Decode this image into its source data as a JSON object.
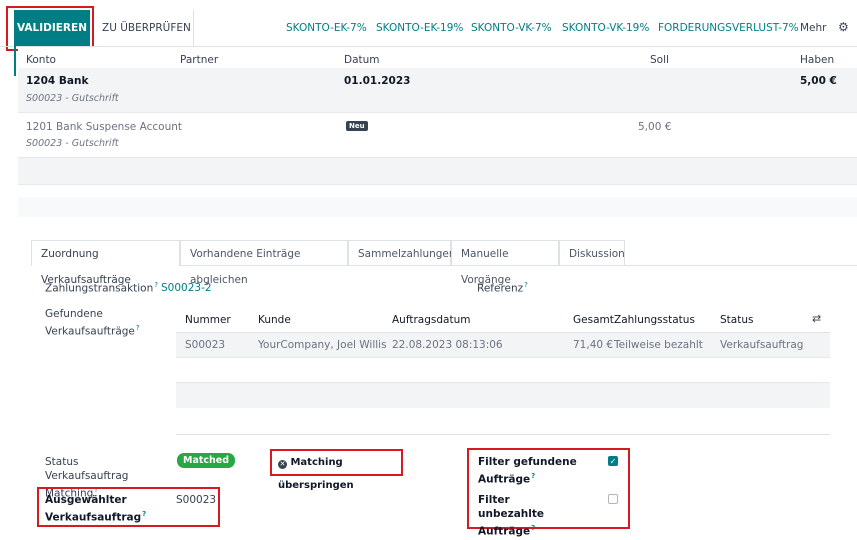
{
  "toolbar": {
    "validate": "VALIDIEREN",
    "to_check": "ZU ÜBERPRÜFEN",
    "actions": [
      "SKONTO-EK-7%",
      "SKONTO-EK-19%",
      "SKONTO-VK-7%",
      "SKONTO-VK-19%",
      "FORDERUNGSVERLUST-7%"
    ],
    "more": "Mehr"
  },
  "lines_table": {
    "headers": {
      "account": "Konto",
      "partner": "Partner",
      "date": "Datum",
      "debit": "Soll",
      "credit": "Haben"
    },
    "rows": [
      {
        "account": "1204 Bank",
        "label": "S00023 - Gutschrift",
        "date": "01.01.2023",
        "debit": "",
        "credit": "5,00 €"
      },
      {
        "account": "1201 Bank Suspense Account",
        "label": "S00023 - Gutschrift",
        "badge": "Neu",
        "debit": "5,00 €",
        "credit": ""
      }
    ]
  },
  "tabs": [
    "Zuordnung Verkaufsaufträge",
    "Vorhandene Einträge abgleichen",
    "Sammelzahlungen",
    "Manuelle Vorgänge",
    "Diskussion"
  ],
  "form": {
    "transaction_label": "Zahlungstransaktion",
    "transaction_value": "S00023-2",
    "reference_label": "Referenz",
    "found_orders_label": "Gefundene Verkaufsaufträge",
    "status_matching_label": "Status Verkaufsauftrag Matching",
    "status_matching_value": "Matched",
    "skip_matching": "Matching überspringen",
    "selected_order_label": "Ausgewählter Verkaufsauftrag",
    "selected_order_value": "S00023",
    "filter_found_label": "Filter gefundene Aufträge",
    "filter_found_checked": true,
    "filter_unpaid_label": "Filter unbezahlte Aufträge",
    "filter_unpaid_checked": false
  },
  "orders_table": {
    "headers": {
      "number": "Nummer",
      "customer": "Kunde",
      "date": "Auftragsdatum",
      "total": "Gesamt",
      "payment_status": "Zahlungsstatus",
      "status": "Status"
    },
    "rows": [
      {
        "number": "S00023",
        "customer": "YourCompany, Joel Willis",
        "date": "22.08.2023 08:13:06",
        "total": "71,40 €",
        "payment_status": "Teilweise bezahlt",
        "status": "Verkaufsauftrag"
      }
    ]
  },
  "colors": {
    "accent": "#017e84",
    "matched_badge": "#28a745",
    "highlight": "#d71920"
  }
}
